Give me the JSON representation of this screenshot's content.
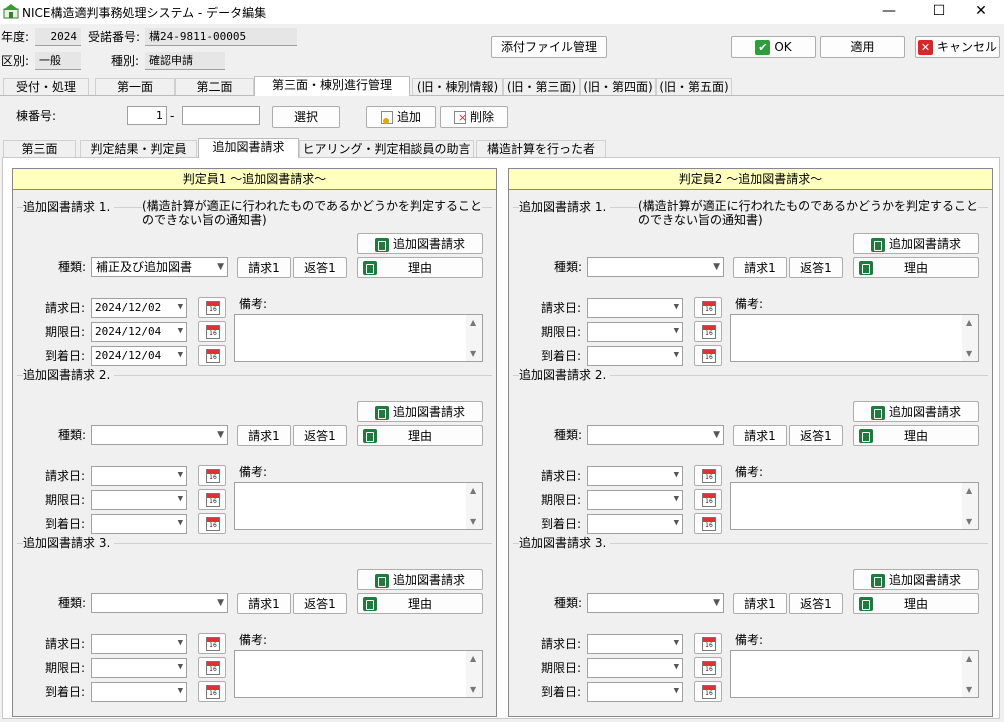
{
  "window": {
    "title": "NICE構造適判事務処理システム - データ編集",
    "minimize": "—",
    "maximize": "☐",
    "close": "✕"
  },
  "header": {
    "year_label": "年度:",
    "year_value": "2024",
    "receipt_label": "受諾番号:",
    "receipt_value": "構24-9811-00005",
    "category_label": "区別:",
    "category_value": "一般",
    "type_label": "種別:",
    "type_value": "確認申請",
    "attach_button": "添付ファイル管理",
    "ok_button": "OK",
    "apply_button": "適用",
    "cancel_button": "キャンセル"
  },
  "main_tabs": [
    "受付・処理",
    "第一面",
    "第二面",
    "第三面・棟別進行管理",
    "(旧・棟別情報)",
    "(旧・第三面)",
    "(旧・第四面)",
    "(旧・第五面)"
  ],
  "building": {
    "label": "棟番号:",
    "value": "1",
    "dash": "-",
    "value2": "",
    "select_button": "選択",
    "add_button": "追加",
    "delete_button": "削除"
  },
  "sub_tabs": [
    "第三面",
    "判定結果・判定員",
    "追加図書請求",
    "ヒアリング・判定相談員の助言",
    "構造計算を行った者"
  ],
  "common": {
    "req_btn": "追加図書請求",
    "reason_btn": "理由",
    "type_label": "種類:",
    "req1_btn": "請求1",
    "resp1_btn": "返答1",
    "date_req_label": "請求日:",
    "date_due_label": "期限日:",
    "date_arr_label": "到着日:",
    "memo_label": "備考:",
    "cal_num": "16",
    "note": "(構造計算が適正に行われたものであるかどうかを判定することのできない旨の通知書)"
  },
  "judges": [
    {
      "title": "判定員1 〜追加図書請求〜",
      "groups": [
        {
          "title": "追加図書請求 1.",
          "type": "補正及び追加図書",
          "date_req": "2024/12/02",
          "date_due": "2024/12/04",
          "date_arr": "2024/12/04",
          "memo": ""
        },
        {
          "title": "追加図書請求 2.",
          "type": "",
          "date_req": "",
          "date_due": "",
          "date_arr": "",
          "memo": ""
        },
        {
          "title": "追加図書請求 3.",
          "type": "",
          "date_req": "",
          "date_due": "",
          "date_arr": "",
          "memo": ""
        }
      ]
    },
    {
      "title": "判定員2 〜追加図書請求〜",
      "groups": [
        {
          "title": "追加図書請求 1.",
          "type": "",
          "date_req": "",
          "date_due": "",
          "date_arr": "",
          "memo": ""
        },
        {
          "title": "追加図書請求 2.",
          "type": "",
          "date_req": "",
          "date_due": "",
          "date_arr": "",
          "memo": ""
        },
        {
          "title": "追加図書請求 3.",
          "type": "",
          "date_req": "",
          "date_due": "",
          "date_arr": "",
          "memo": ""
        }
      ]
    }
  ]
}
